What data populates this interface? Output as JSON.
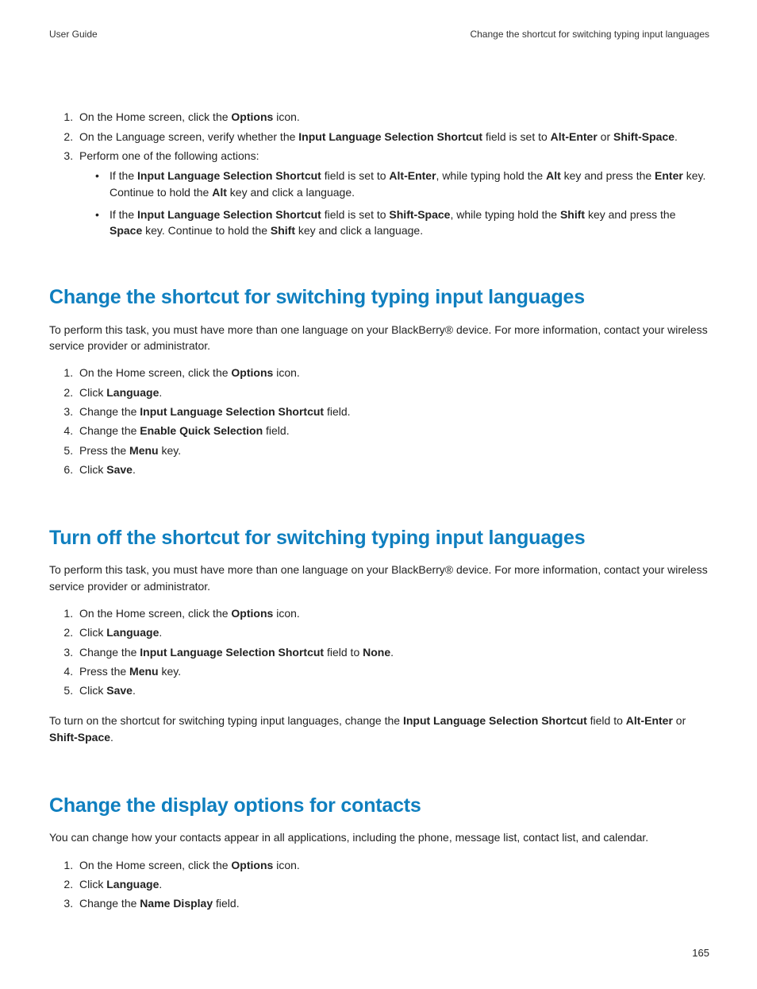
{
  "header": {
    "left": "User Guide",
    "right": "Change the shortcut for switching typing input languages"
  },
  "top": {
    "s1a": "On the Home screen, click the ",
    "s1b": "Options",
    "s1c": " icon.",
    "s2a": "On the Language screen, verify whether the ",
    "s2b": "Input Language Selection Shortcut",
    "s2c": " field is set to ",
    "s2d": "Alt-Enter",
    "s2e": " or ",
    "s2f": "Shift-Space",
    "s2g": ".",
    "s3": "Perform one of the following actions:",
    "b1a": "If the ",
    "b1b": "Input Language Selection Shortcut",
    "b1c": " field is set to ",
    "b1d": "Alt-Enter",
    "b1e": ", while typing hold the ",
    "b1f": "Alt",
    "b1g": " key and press the ",
    "b1h": "Enter",
    "b1i": " key. Continue to hold the ",
    "b1j": "Alt",
    "b1k": " key and click a language.",
    "b2a": "If the ",
    "b2b": "Input Language Selection Shortcut",
    "b2c": " field is set to ",
    "b2d": "Shift-Space",
    "b2e": ", while typing hold the ",
    "b2f": "Shift",
    "b2g": " key and press the ",
    "b2h": "Space",
    "b2i": " key. Continue to hold the ",
    "b2j": "Shift",
    "b2k": " key and click a language."
  },
  "secA": {
    "title": "Change the shortcut for switching typing input languages",
    "intro": "To perform this task, you must have more than one language on your BlackBerry® device. For more information, contact your wireless service provider or administrator.",
    "s1a": "On the Home screen, click the ",
    "s1b": "Options",
    "s1c": " icon.",
    "s2a": "Click ",
    "s2b": "Language",
    "s2c": ".",
    "s3a": "Change the ",
    "s3b": "Input Language Selection Shortcut",
    "s3c": " field.",
    "s4a": "Change the ",
    "s4b": "Enable Quick Selection",
    "s4c": " field.",
    "s5a": "Press the ",
    "s5b": "Menu",
    "s5c": " key.",
    "s6a": "Click ",
    "s6b": "Save",
    "s6c": "."
  },
  "secB": {
    "title": "Turn off the shortcut for switching typing input languages",
    "intro": "To perform this task, you must have more than one language on your BlackBerry® device. For more information, contact your wireless service provider or administrator.",
    "s1a": "On the Home screen, click the ",
    "s1b": "Options",
    "s1c": " icon.",
    "s2a": "Click ",
    "s2b": "Language",
    "s2c": ".",
    "s3a": "Change the ",
    "s3b": "Input Language Selection Shortcut",
    "s3c": " field to ",
    "s3d": "None",
    "s3e": ".",
    "s4a": "Press the ",
    "s4b": "Menu",
    "s4c": " key.",
    "s5a": "Click ",
    "s5b": "Save",
    "s5c": ".",
    "afterA": "To turn on the shortcut for switching typing input languages, change the ",
    "afterB": "Input Language Selection Shortcut",
    "afterC": " field to ",
    "afterD": "Alt-Enter",
    "afterE": " or ",
    "afterF": "Shift-Space",
    "afterG": "."
  },
  "secC": {
    "title": "Change the display options for contacts",
    "intro": "You can change how your contacts appear in all applications, including the phone, message list, contact list, and calendar.",
    "s1a": "On the Home screen, click the ",
    "s1b": "Options",
    "s1c": " icon.",
    "s2a": "Click ",
    "s2b": "Language",
    "s2c": ".",
    "s3a": "Change the ",
    "s3b": "Name Display",
    "s3c": " field."
  },
  "pageNumber": "165"
}
